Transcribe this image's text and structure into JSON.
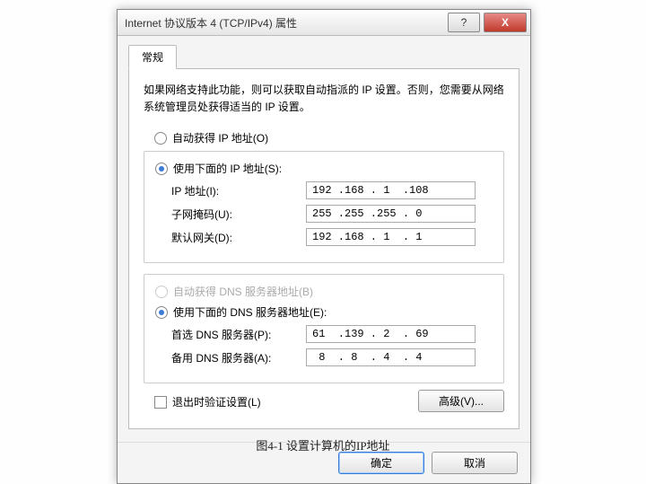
{
  "titlebar": {
    "title": "Internet 协议版本 4 (TCP/IPv4) 属性"
  },
  "tabs": {
    "general": "常规"
  },
  "description": "如果网络支持此功能，则可以获取自动指派的 IP 设置。否则，您需要从网络系统管理员处获得适当的 IP 设置。",
  "ip_section": {
    "auto_label": "自动获得 IP 地址(O)",
    "manual_label": "使用下面的 IP 地址(S):",
    "fields": {
      "ip_label": "IP 地址(I):",
      "ip_value": "192 .168 . 1  .108",
      "mask_label": "子网掩码(U):",
      "mask_value": "255 .255 .255 . 0",
      "gateway_label": "默认网关(D):",
      "gateway_value": "192 .168 . 1  . 1"
    }
  },
  "dns_section": {
    "auto_label": "自动获得 DNS 服务器地址(B)",
    "manual_label": "使用下面的 DNS 服务器地址(E):",
    "fields": {
      "pref_label": "首选 DNS 服务器(P):",
      "pref_value": "61  .139 . 2  . 69",
      "alt_label": "备用 DNS 服务器(A):",
      "alt_value": " 8  . 8  . 4  . 4"
    }
  },
  "validate_checkbox": "退出时验证设置(L)",
  "advanced_button": "高级(V)...",
  "buttons": {
    "ok": "确定",
    "cancel": "取消"
  },
  "caption": "图4-1  设置计算机的IP地址"
}
